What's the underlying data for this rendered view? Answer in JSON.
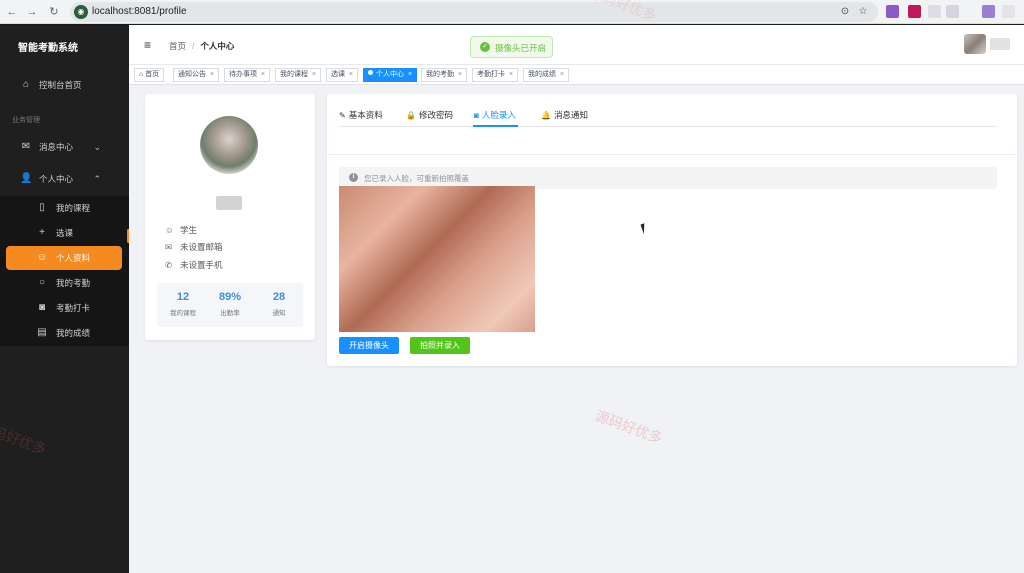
{
  "browser": {
    "url": "localhost:8081/profile",
    "back_glyph": "←",
    "forward_glyph": "→",
    "reload_glyph": "↻",
    "location_glyph": "⊙",
    "star_glyph": "☆"
  },
  "sidebar": {
    "brand": "智能考勤系统",
    "group_label": "业务管理",
    "items": [
      {
        "label": "控制台首页",
        "icon": "home-icon",
        "glyph": "⌂"
      },
      {
        "label": "消息中心",
        "icon": "mail-icon",
        "glyph": "✉",
        "chevron": "⌄"
      },
      {
        "label": "个人中心",
        "icon": "user-icon",
        "glyph": "👤",
        "chevron": "⌃"
      }
    ],
    "subitems": [
      {
        "label": "我的课程",
        "icon": "book-icon",
        "glyph": "▯"
      },
      {
        "label": "选课",
        "icon": "plus-icon",
        "glyph": "+"
      },
      {
        "label": "个人资料",
        "icon": "user-icon",
        "glyph": "☺"
      },
      {
        "label": "我的考勤",
        "icon": "search-icon",
        "glyph": "○"
      },
      {
        "label": "考勤打卡",
        "icon": "camera-icon",
        "glyph": "◙"
      },
      {
        "label": "我的成绩",
        "icon": "document-icon",
        "glyph": "▤"
      }
    ],
    "active_item": "个人资料"
  },
  "header": {
    "menu_glyph": "≡",
    "breadcrumb": [
      "首页",
      "个人中心"
    ],
    "breadcrumb_sep": "/",
    "toast": "摄像头已开启",
    "toast_glyph": "✓"
  },
  "tags": [
    {
      "label": "首页",
      "closable": false,
      "glyph": "⌂"
    },
    {
      "label": "通知公告",
      "closable": true
    },
    {
      "label": "待办事项",
      "closable": true
    },
    {
      "label": "我的课程",
      "closable": true
    },
    {
      "label": "选课",
      "closable": true
    },
    {
      "label": "个人中心",
      "closable": true,
      "active": true
    },
    {
      "label": "我的考勤",
      "closable": true
    },
    {
      "label": "考勤打卡",
      "closable": true
    },
    {
      "label": "我的成绩",
      "closable": true
    }
  ],
  "tag_close_glyph": "×",
  "profile": {
    "role": "学生",
    "email": "未设置邮箱",
    "phone": "未设置手机",
    "role_glyph": "☺",
    "email_glyph": "✉",
    "phone_glyph": "✆",
    "stats": [
      {
        "value": "12",
        "label": "我的课程"
      },
      {
        "value": "89%",
        "label": "出勤率"
      },
      {
        "value": "28",
        "label": "通知"
      }
    ]
  },
  "tabs": [
    {
      "label": "基本资料",
      "glyph": "✎"
    },
    {
      "label": "修改密码",
      "glyph": "🔒"
    },
    {
      "label": "人脸录入",
      "glyph": "◙",
      "active": true
    },
    {
      "label": "消息通知",
      "glyph": "🔔"
    }
  ],
  "face": {
    "info_glyph": "i",
    "notice": "您已录入人脸，可重新拍照覆盖",
    "btn_open_camera": "开启摄像头",
    "btn_capture": "拍照并录入"
  },
  "watermark": "源码好优多",
  "colors": {
    "accent": "#1890ff",
    "sidebar_active": "#f58a1f",
    "success": "#52c41a"
  }
}
